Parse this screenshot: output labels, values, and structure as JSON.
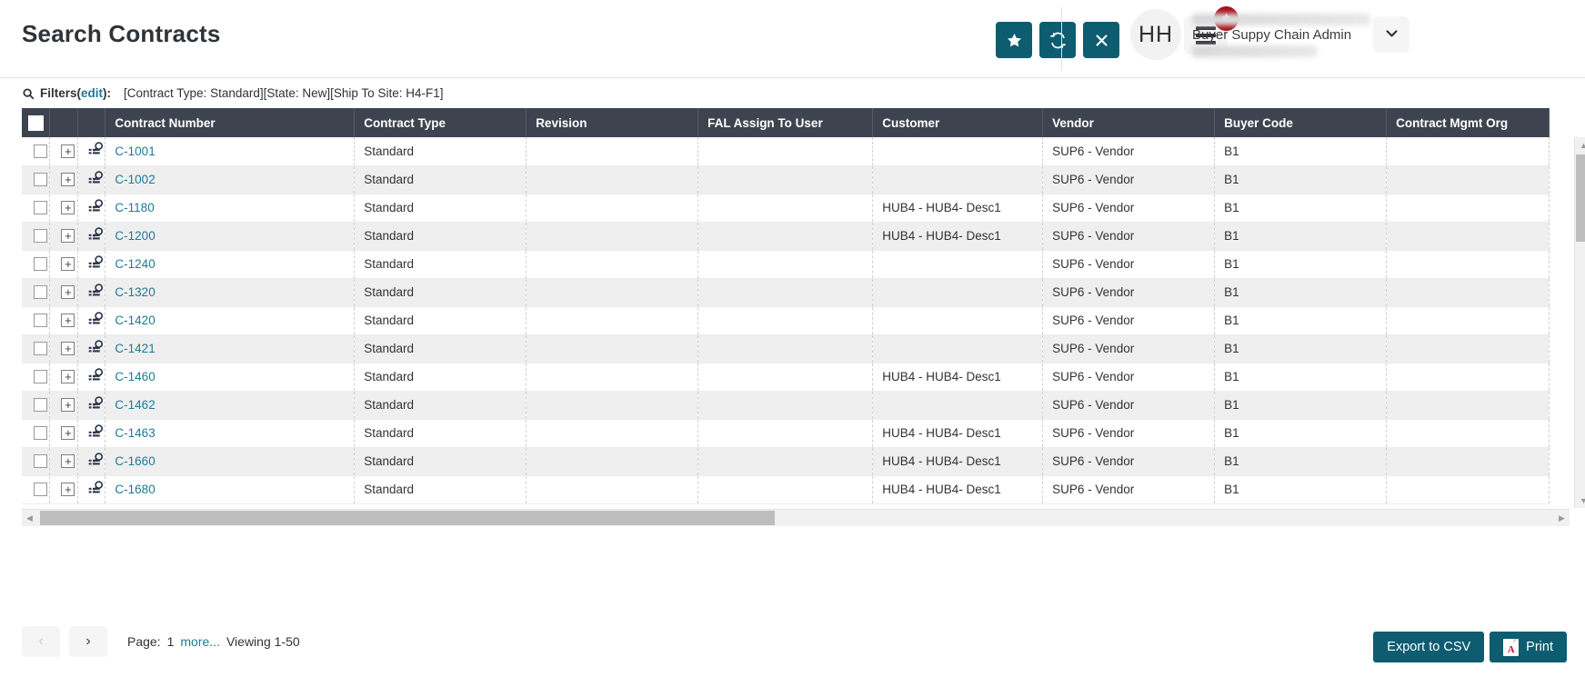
{
  "header": {
    "title": "Search Contracts",
    "actions": [
      {
        "name": "favorite-button",
        "icon": "star-icon"
      },
      {
        "name": "refresh-button",
        "icon": "refresh-icon"
      },
      {
        "name": "close-button",
        "icon": "close-icon"
      }
    ],
    "menu_badge_icon": "star-icon",
    "user": {
      "initials": "HH",
      "role": "Buyer Suppy Chain Admin",
      "name_redacted": "",
      "secondary_redacted": ""
    },
    "accent_color": "#0d5c70",
    "badge_color": "#a5101a"
  },
  "filters": {
    "icon": "search-icon",
    "label": "Filters",
    "open_paren": "(",
    "edit_link": "edit",
    "close_paren": "):",
    "values": "[Contract Type: Standard][State: New][Ship To Site: H4-F1]"
  },
  "table": {
    "columns": [
      "Contract Number",
      "Contract Type",
      "Revision",
      "FAL Assign To User",
      "Customer",
      "Vendor",
      "Buyer Code",
      "Contract Mgmt Org"
    ],
    "rows": [
      {
        "contract_number": "C-1001",
        "contract_type": "Standard",
        "revision": "",
        "fal_assign_to_user": "",
        "customer": "",
        "vendor": "SUP6 - Vendor",
        "buyer_code": "B1",
        "contract_mgmt_org": ""
      },
      {
        "contract_number": "C-1002",
        "contract_type": "Standard",
        "revision": "",
        "fal_assign_to_user": "",
        "customer": "",
        "vendor": "SUP6 - Vendor",
        "buyer_code": "B1",
        "contract_mgmt_org": ""
      },
      {
        "contract_number": "C-1180",
        "contract_type": "Standard",
        "revision": "",
        "fal_assign_to_user": "",
        "customer": "HUB4 - HUB4- Desc1",
        "vendor": "SUP6 - Vendor",
        "buyer_code": "B1",
        "contract_mgmt_org": ""
      },
      {
        "contract_number": "C-1200",
        "contract_type": "Standard",
        "revision": "",
        "fal_assign_to_user": "",
        "customer": "HUB4 - HUB4- Desc1",
        "vendor": "SUP6 - Vendor",
        "buyer_code": "B1",
        "contract_mgmt_org": ""
      },
      {
        "contract_number": "C-1240",
        "contract_type": "Standard",
        "revision": "",
        "fal_assign_to_user": "",
        "customer": "",
        "vendor": "SUP6 - Vendor",
        "buyer_code": "B1",
        "contract_mgmt_org": ""
      },
      {
        "contract_number": "C-1320",
        "contract_type": "Standard",
        "revision": "",
        "fal_assign_to_user": "",
        "customer": "",
        "vendor": "SUP6 - Vendor",
        "buyer_code": "B1",
        "contract_mgmt_org": ""
      },
      {
        "contract_number": "C-1420",
        "contract_type": "Standard",
        "revision": "",
        "fal_assign_to_user": "",
        "customer": "",
        "vendor": "SUP6 - Vendor",
        "buyer_code": "B1",
        "contract_mgmt_org": ""
      },
      {
        "contract_number": "C-1421",
        "contract_type": "Standard",
        "revision": "",
        "fal_assign_to_user": "",
        "customer": "",
        "vendor": "SUP6 - Vendor",
        "buyer_code": "B1",
        "contract_mgmt_org": ""
      },
      {
        "contract_number": "C-1460",
        "contract_type": "Standard",
        "revision": "",
        "fal_assign_to_user": "",
        "customer": "HUB4 - HUB4- Desc1",
        "vendor": "SUP6 - Vendor",
        "buyer_code": "B1",
        "contract_mgmt_org": ""
      },
      {
        "contract_number": "C-1462",
        "contract_type": "Standard",
        "revision": "",
        "fal_assign_to_user": "",
        "customer": "",
        "vendor": "SUP6 - Vendor",
        "buyer_code": "B1",
        "contract_mgmt_org": ""
      },
      {
        "contract_number": "C-1463",
        "contract_type": "Standard",
        "revision": "",
        "fal_assign_to_user": "",
        "customer": "HUB4 - HUB4- Desc1",
        "vendor": "SUP6 - Vendor",
        "buyer_code": "B1",
        "contract_mgmt_org": ""
      },
      {
        "contract_number": "C-1660",
        "contract_type": "Standard",
        "revision": "",
        "fal_assign_to_user": "",
        "customer": "HUB4 - HUB4- Desc1",
        "vendor": "SUP6 - Vendor",
        "buyer_code": "B1",
        "contract_mgmt_org": ""
      },
      {
        "contract_number": "C-1680",
        "contract_type": "Standard",
        "revision": "",
        "fal_assign_to_user": "",
        "customer": "HUB4 - HUB4- Desc1",
        "vendor": "SUP6 - Vendor",
        "buyer_code": "B1",
        "contract_mgmt_org": ""
      }
    ],
    "row_expand_icon": "plus-square-icon",
    "row_detail_icon": "list-search-icon",
    "header_bg": "#3d4450",
    "link_color": "#1b7b96"
  },
  "footer": {
    "prev_label": "‹",
    "next_label": "›",
    "page_label": "Page:",
    "page_number": "1",
    "more_link": "more...",
    "viewing": "Viewing 1-50",
    "export_label": "Export to CSV",
    "print_label": "Print",
    "print_icon": "pdf-icon"
  }
}
